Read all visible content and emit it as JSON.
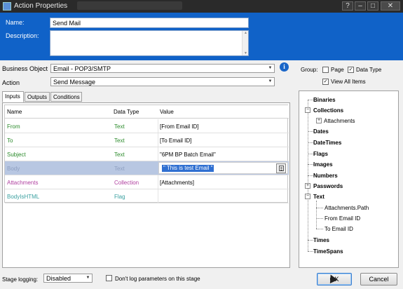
{
  "window": {
    "title": "Action Properties",
    "help_label": "?",
    "min_label": "–",
    "max_label": "□",
    "close_label": "✕"
  },
  "header": {
    "name_label": "Name:",
    "name_value": "Send Mail",
    "description_label": "Description:",
    "description_value": ""
  },
  "form": {
    "business_object_label": "Business Object",
    "business_object_value": "Email - POP3/SMTP",
    "action_label": "Action",
    "action_value": "Send Message"
  },
  "tabs": [
    {
      "label": "Inputs",
      "active": true
    },
    {
      "label": "Outputs",
      "active": false
    },
    {
      "label": "Conditions",
      "active": false
    }
  ],
  "grid": {
    "columns": [
      "Name",
      "Data Type",
      "Value"
    ],
    "rows": [
      {
        "name": "From",
        "type": "Text",
        "value": "[From Email ID]",
        "color": "#2a8a2a"
      },
      {
        "name": "To",
        "type": "Text",
        "value": "[To Email ID]",
        "color": "#2a8a2a"
      },
      {
        "name": "Subject",
        "type": "Text",
        "value": "\"6PM BP Batch Email\"",
        "color": "#2a8a2a"
      },
      {
        "name": "Body",
        "type": "Text",
        "value": "\" This is test Email \"",
        "color": "#8e9fc0"
      },
      {
        "name": "Attachments",
        "type": "Collection",
        "value": "[Attachments]",
        "color": "#b040a0"
      },
      {
        "name": "BodyIsHTML",
        "type": "Flag",
        "value": "",
        "color": "#3aa0a0"
      }
    ]
  },
  "group": {
    "label": "Group:",
    "page_label": "Page",
    "page_checked": false,
    "data_type_label": "Data Type",
    "data_type_checked": true,
    "view_all_label": "View All Items",
    "view_all_checked": true
  },
  "tree": {
    "binaries": "Binaries",
    "collections": "Collections",
    "attachments": "Attachments",
    "dates": "Dates",
    "datetimes": "DateTimes",
    "flags": "Flags",
    "images": "Images",
    "numbers": "Numbers",
    "passwords": "Passwords",
    "text": "Text",
    "text_children": [
      "Attachments.Path",
      "From Email ID",
      "To Email ID"
    ],
    "times": "Times",
    "timespans": "TimeSpans"
  },
  "bottom": {
    "stage_logging_label": "Stage logging:",
    "stage_logging_value": "Disabled",
    "dont_log_label": "Don't log parameters on this stage",
    "ok_label": "OK",
    "cancel_label": "Cancel"
  },
  "icons": {
    "expanded": "−",
    "collapsed": "+",
    "dropdown": "▼",
    "check": "✓",
    "info": "i"
  }
}
